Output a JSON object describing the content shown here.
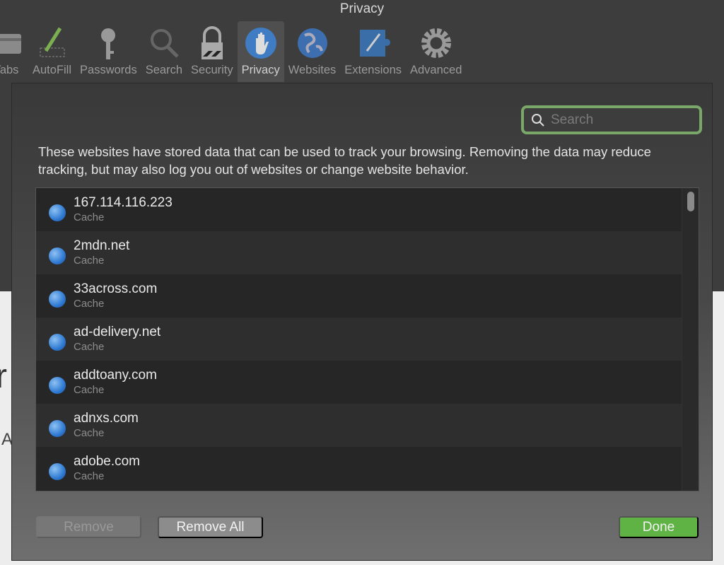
{
  "window": {
    "title": "Privacy"
  },
  "toolbar": {
    "items": [
      {
        "label": "Tabs",
        "icon": "tabs-icon"
      },
      {
        "label": "AutoFill",
        "icon": "pencil-icon"
      },
      {
        "label": "Passwords",
        "icon": "key-icon"
      },
      {
        "label": "Search",
        "icon": "search-icon"
      },
      {
        "label": "Security",
        "icon": "lock-icon"
      },
      {
        "label": "Privacy",
        "icon": "hand-icon",
        "selected": true
      },
      {
        "label": "Websites",
        "icon": "globe-icon"
      },
      {
        "label": "Extensions",
        "icon": "extensions-icon"
      },
      {
        "label": "Advanced",
        "icon": "gear-icon"
      }
    ]
  },
  "background": {
    "fragment1": "r",
    "fragment2": "A"
  },
  "sheet": {
    "search_placeholder": "Search",
    "search_focus_color": "#79a869",
    "description": "These websites have stored data that can be used to track your browsing. Removing the data may reduce tracking, but may also log you out of websites or change website behavior.",
    "websites": [
      {
        "name": "167.114.116.223",
        "data": "Cache"
      },
      {
        "name": "2mdn.net",
        "data": "Cache"
      },
      {
        "name": "33across.com",
        "data": "Cache"
      },
      {
        "name": "ad-delivery.net",
        "data": "Cache"
      },
      {
        "name": "addtoany.com",
        "data": "Cache"
      },
      {
        "name": "adnxs.com",
        "data": "Cache"
      },
      {
        "name": "adobe.com",
        "data": "Cache"
      }
    ],
    "buttons": {
      "remove": "Remove",
      "remove_all": "Remove All",
      "done": "Done"
    },
    "accent_done": "#5fb244"
  }
}
